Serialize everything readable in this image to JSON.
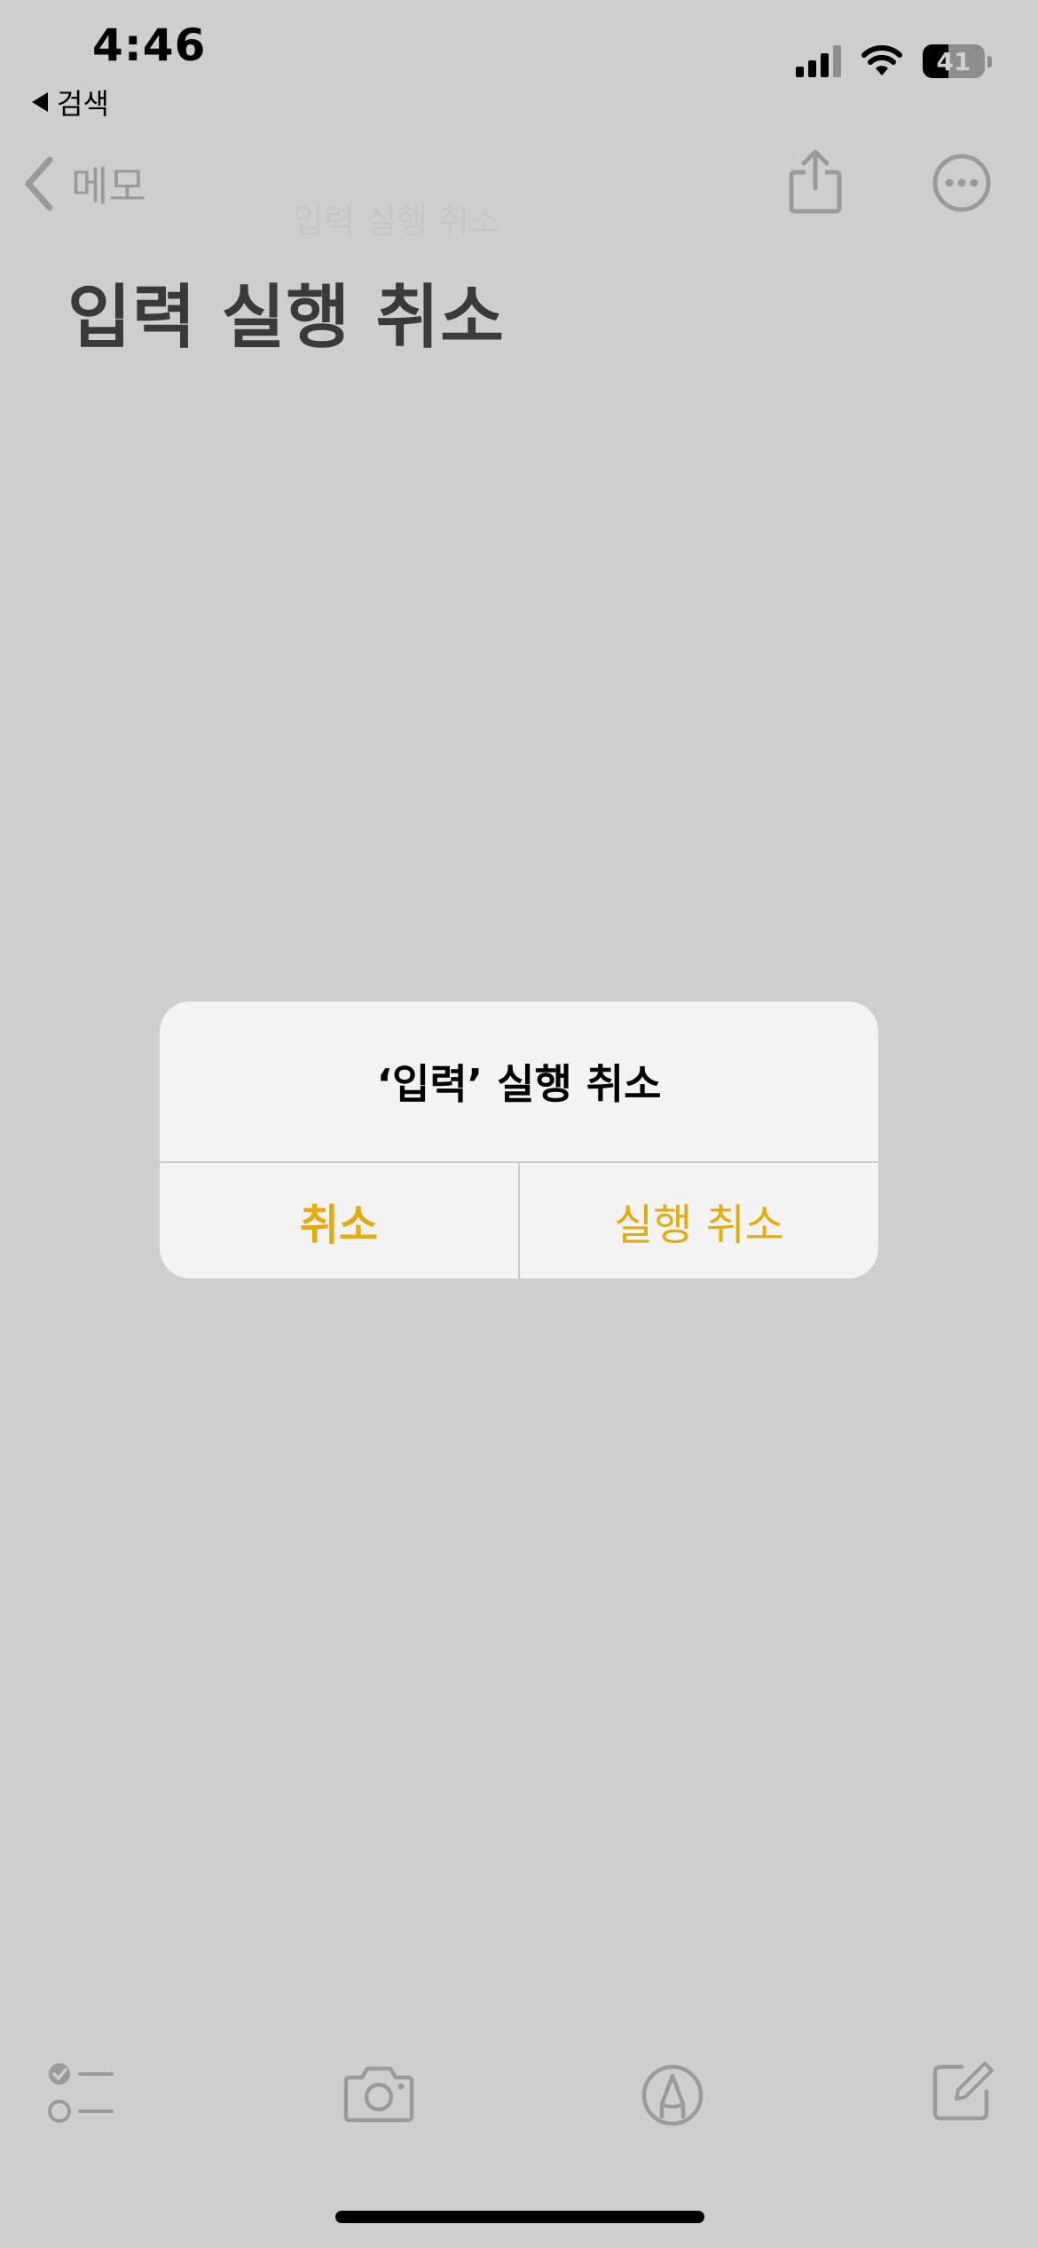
{
  "status_bar": {
    "time": "4:46",
    "back_label": "검색",
    "battery_level": "41"
  },
  "nav": {
    "back_label": "메모",
    "faint_title": "입력 실행 취소"
  },
  "note": {
    "title": "입력 실행 취소"
  },
  "alert": {
    "title": "‘입력’ 실행 취소",
    "cancel_label": "취소",
    "undo_label": "실행 취소"
  },
  "colors": {
    "background": "#cecece",
    "alert_background": "#f3f3f3",
    "accent": "#e3ab10",
    "dimmed_icon": "#9a9a9a"
  },
  "icons": {
    "checklist": "checklist-icon",
    "camera": "camera-icon",
    "markup": "pen-tip-circle-icon",
    "compose": "compose-icon",
    "share": "share-icon",
    "more": "ellipsis-circle-icon"
  }
}
